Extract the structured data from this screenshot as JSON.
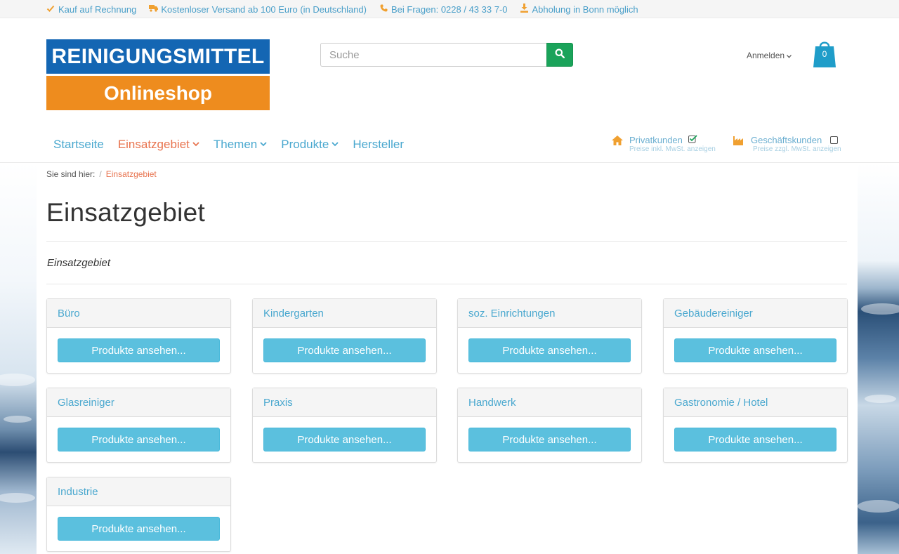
{
  "topbar": {
    "items": [
      {
        "icon": "check-icon",
        "text": "Kauf auf Rechnung"
      },
      {
        "icon": "truck-icon",
        "text": "Kostenloser Versand ab 100 Euro (in Deutschland)"
      },
      {
        "icon": "phone-icon",
        "text": "Bei Fragen: 0228 / 43 33 7-0"
      },
      {
        "icon": "download-icon",
        "text": "Abholung in Bonn möglich"
      }
    ]
  },
  "logo": {
    "line1": "REINIGUNGSMITTEL",
    "line2": "Onlineshop"
  },
  "search": {
    "placeholder": "Suche",
    "value": ""
  },
  "account": {
    "login_label": "Anmelden"
  },
  "cart": {
    "count": "0"
  },
  "nav": {
    "items": [
      {
        "label": "Startseite",
        "has_dropdown": false,
        "active": false
      },
      {
        "label": "Einsatzgebiet",
        "has_dropdown": true,
        "active": true
      },
      {
        "label": "Themen",
        "has_dropdown": true,
        "active": false
      },
      {
        "label": "Produkte",
        "has_dropdown": true,
        "active": false
      },
      {
        "label": "Hersteller",
        "has_dropdown": false,
        "active": false
      }
    ]
  },
  "customer_type": {
    "private": {
      "label": "Privatkunden",
      "sub": "Preise inkl. MwSt. anzeigen",
      "checked": true
    },
    "business": {
      "label": "Geschäftskunden",
      "sub": "Preise zzgl. MwSt. anzeigen",
      "checked": false
    }
  },
  "breadcrumb": {
    "prefix": "Sie sind hier:",
    "separator": "/",
    "current": "Einsatzgebiet"
  },
  "page": {
    "title": "Einsatzgebiet",
    "subtitle": "Einsatzgebiet"
  },
  "categories": [
    {
      "name": "Büro",
      "button": "Produkte ansehen..."
    },
    {
      "name": "Kindergarten",
      "button": "Produkte ansehen..."
    },
    {
      "name": "soz. Einrichtungen",
      "button": "Produkte ansehen..."
    },
    {
      "name": "Gebäudereiniger",
      "button": "Produkte ansehen..."
    },
    {
      "name": "Glasreiniger",
      "button": "Produkte ansehen..."
    },
    {
      "name": "Praxis",
      "button": "Produkte ansehen..."
    },
    {
      "name": "Handwerk",
      "button": "Produkte ansehen..."
    },
    {
      "name": "Gastronomie / Hotel",
      "button": "Produkte ansehen..."
    },
    {
      "name": "Industrie",
      "button": "Produkte ansehen..."
    }
  ],
  "colors": {
    "link": "#4aa8cf",
    "active": "#e8734e",
    "accent_orange": "#f0a030",
    "search_button": "#1aa35a",
    "primary_button": "#5bc0de",
    "logo_blue": "#1466b3",
    "logo_orange": "#ee8c1e",
    "cart": "#1f9dc9"
  }
}
